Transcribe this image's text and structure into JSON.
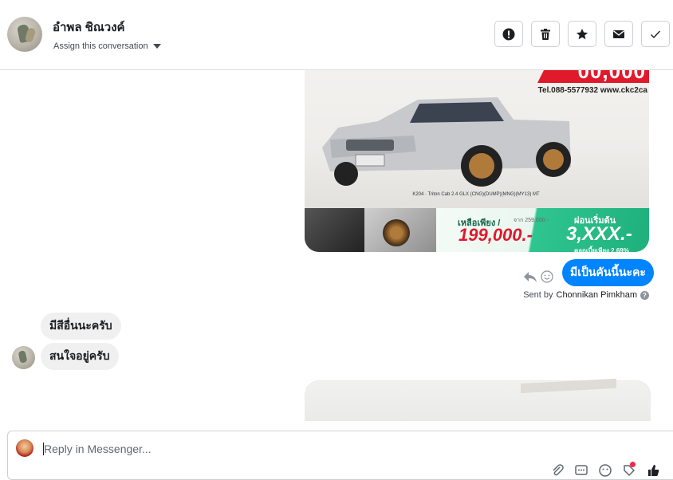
{
  "header": {
    "contact_name": "อำพล ชิณวงค์",
    "assign_label": "Assign this conversation",
    "actions": [
      {
        "name": "spam-icon",
        "label": "Mark as spam"
      },
      {
        "name": "trash-icon",
        "label": "Delete"
      },
      {
        "name": "star-icon",
        "label": "Follow up"
      },
      {
        "name": "envelope-icon",
        "label": "Mark as unread"
      },
      {
        "name": "check-icon",
        "label": "Mark as done"
      }
    ]
  },
  "ad_image": {
    "banner_price": "00,000",
    "contact_line": "Tel.088-5577932  www.ckc2ca",
    "plate_strip": "K204 · Triton Cab 2.4 GLX (CNG)(DUMP)(MNG)(MY13) MT",
    "remain_label": "เหลือเพียง /",
    "remain_old": "จาก 259,000.-",
    "price": "199,000.-",
    "down_label": "ผ่อนเริ่มต้น",
    "down_value": "3,XXX.-",
    "interest": "ดอกเบี้ยเพียง 2.69%"
  },
  "messages": {
    "outgoing_text": "มีเป็นคันนี้นะคะ",
    "sent_by_prefix": "Sent by",
    "sent_by_name": "Chonnikan Pimkham",
    "help_glyph": "?",
    "incoming": [
      {
        "text": "มีสีอื่นนะครับ"
      },
      {
        "text": "สนใจอยู่ครับ"
      }
    ]
  },
  "composer": {
    "placeholder": "Reply in Messenger...",
    "icons": [
      "paperclip-icon",
      "saved-replies-icon",
      "emoji-icon",
      "label-icon",
      "thumbs-up-icon"
    ]
  },
  "colors": {
    "accent": "#0084ff",
    "incoming_bubble": "#f0f0f0",
    "notification_dot": "#f02849"
  }
}
